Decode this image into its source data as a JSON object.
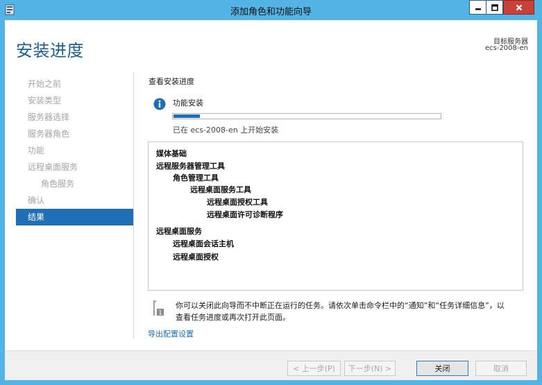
{
  "window": {
    "title": "添加角色和功能向导"
  },
  "header": {
    "page_title": "安装进度",
    "target_label": "目标服务器",
    "target_name": "ecs-2008-en"
  },
  "nav": {
    "items": [
      {
        "label": "开始之前",
        "state": "disabled"
      },
      {
        "label": "安装类型",
        "state": "disabled"
      },
      {
        "label": "服务器选择",
        "state": "disabled"
      },
      {
        "label": "服务器角色",
        "state": "disabled"
      },
      {
        "label": "功能",
        "state": "disabled"
      },
      {
        "label": "远程桌面服务",
        "state": "disabled"
      },
      {
        "label": "角色服务",
        "state": "disabled"
      },
      {
        "label": "确认",
        "state": "disabled"
      },
      {
        "label": "结果",
        "state": "active"
      }
    ]
  },
  "main": {
    "section_label": "查看安装进度",
    "feature_install_label": "功能安装",
    "progress": {
      "fraction": 0.1
    },
    "status_text": "已在 ecs-2008-en 上开始安装",
    "results": [
      "媒体基础",
      "远程服务器管理工具",
      "角色管理工具",
      "远程桌面服务工具",
      "远程桌面授权工具",
      "远程桌面许可诊断程序",
      "远程桌面服务",
      "远程桌面会话主机",
      "远程桌面授权"
    ],
    "note_line1": "你可以关闭此向导而不中断正在运行的任务。请依次单击命令栏中的“通知”和“任务详细信息”，以",
    "note_line2": "查看任务进度或再次打开此页面。",
    "export_link": "导出配置设置"
  },
  "footer": {
    "prev_label": "< 上一步(P)",
    "next_label": "下一步(N) >",
    "close_label": "关闭",
    "cancel_label": "取消"
  },
  "colors": {
    "titlebar": "#53b3e5",
    "accent": "#1e6fb6",
    "title_text": "#1e5f8f",
    "close_button": "#c7423b"
  },
  "icons": {
    "app": "server-manager-icon",
    "info": "info-icon",
    "note": "flag-note-icon"
  }
}
